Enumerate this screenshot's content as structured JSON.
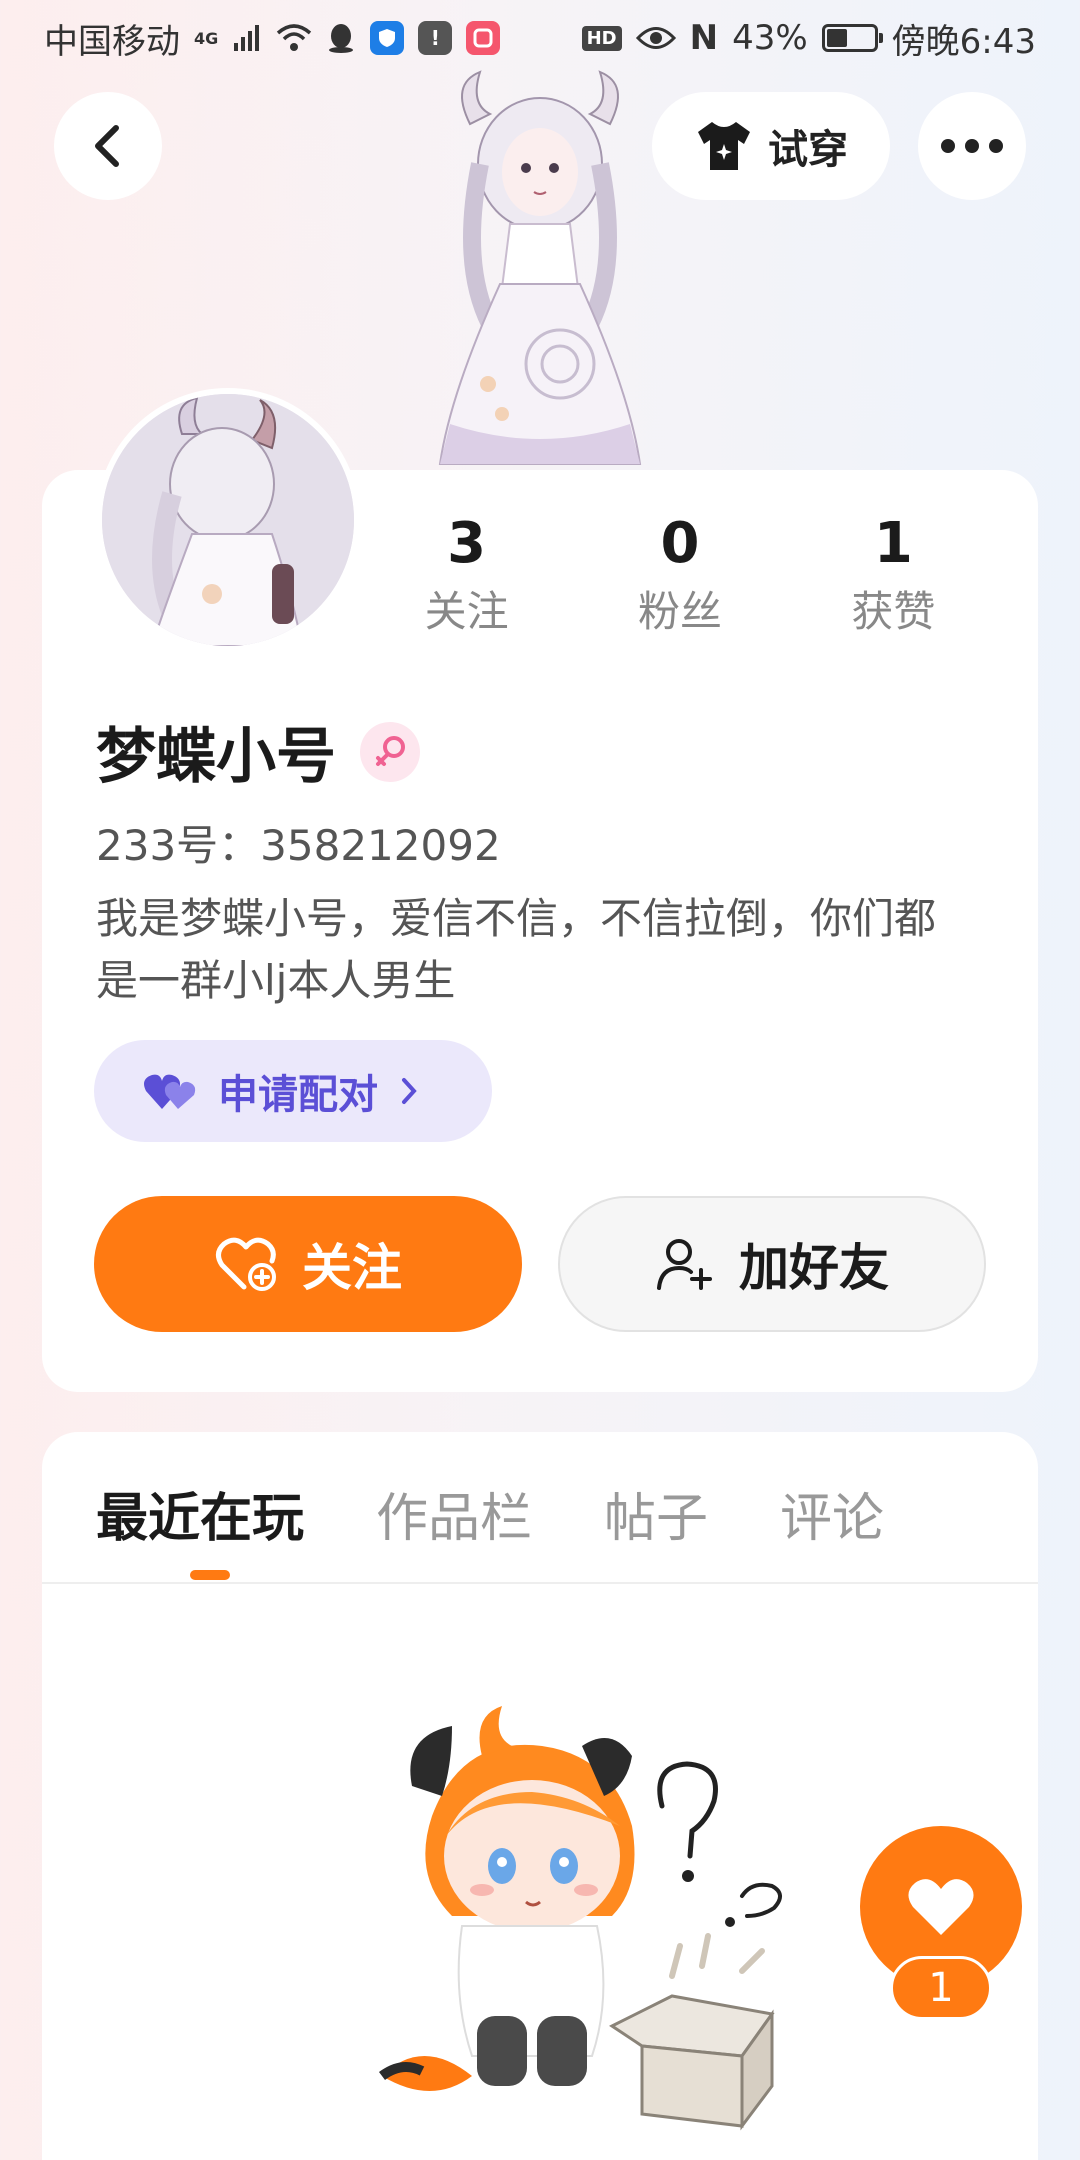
{
  "status_bar": {
    "carrier": "中国移动",
    "network": "4G",
    "hd": "HD",
    "nfc": "N",
    "battery_percent": "43%",
    "battery_level": 0.43,
    "time": "傍晚6:43"
  },
  "header": {
    "back_icon": "chevron-left-icon",
    "tryon_label": "试穿",
    "more_icon": "ellipsis-icon"
  },
  "profile": {
    "stats": [
      {
        "value": "3",
        "label": "关注"
      },
      {
        "value": "0",
        "label": "粉丝"
      },
      {
        "value": "1",
        "label": "获赞"
      }
    ],
    "name": "梦蝶小号",
    "gender_icon": "female-icon",
    "uid": "233号：358212092",
    "bio": "我是梦蝶小号，爱信不信，不信拉倒，你们都是一群小lj本人男生",
    "pair_label": "申请配对",
    "follow_label": "关注",
    "add_friend_label": "加好友"
  },
  "tabs": [
    "最近在玩",
    "作品栏",
    "帖子",
    "评论"
  ],
  "active_tab_index": 0,
  "like": {
    "count": "1"
  },
  "colors": {
    "accent": "#ff7a12",
    "pair_purple": "#5b4fd6",
    "pair_bg": "#ebe8fb",
    "gender_pink": "#f06292"
  }
}
